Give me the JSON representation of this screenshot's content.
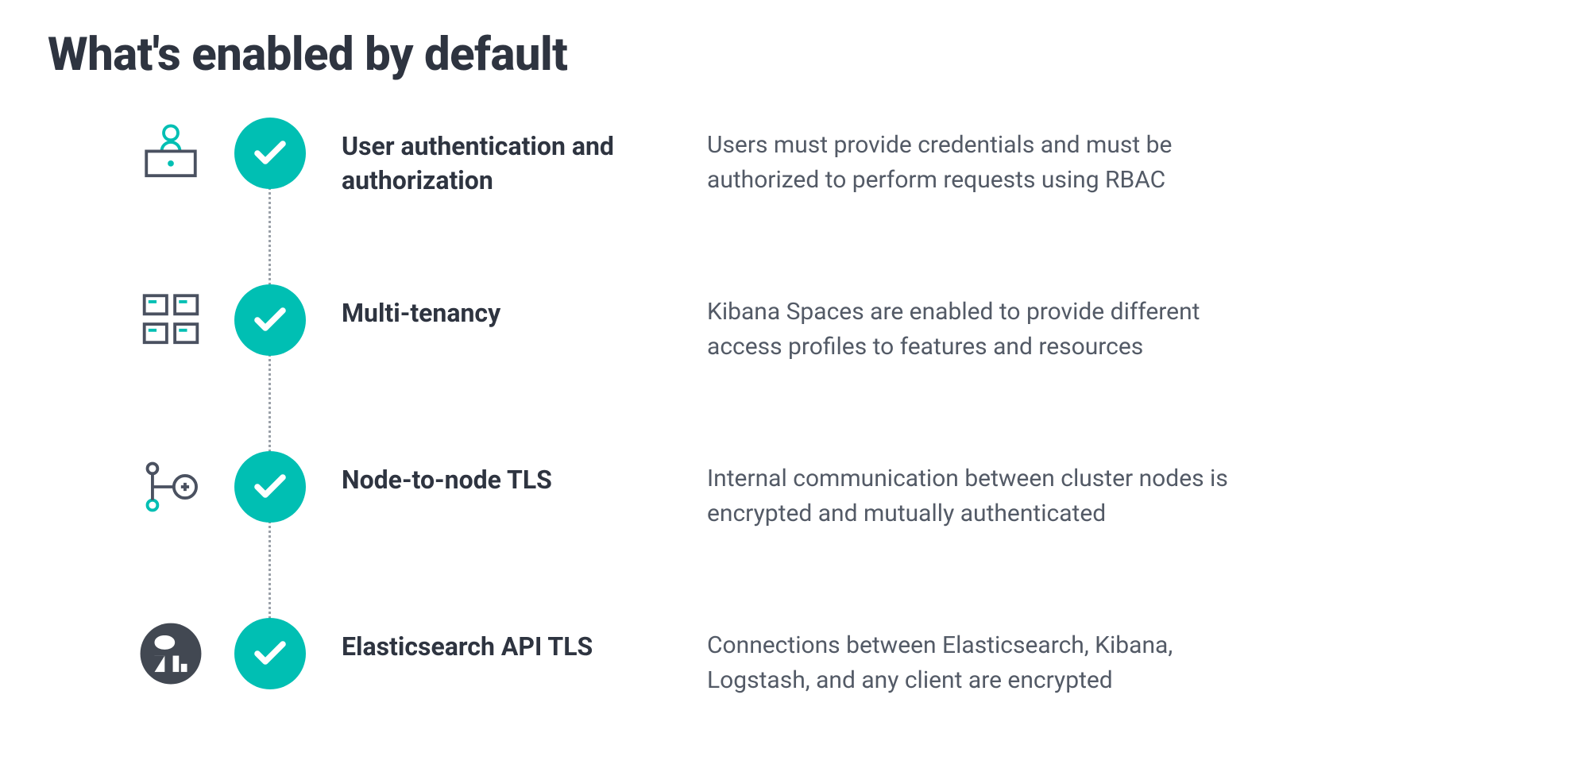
{
  "title": "What's enabled by default",
  "colors": {
    "accent": "#00bfb3",
    "heading": "#2e3440",
    "body": "#535a66"
  },
  "features": [
    {
      "icon": "user-auth-icon",
      "label": "User authentication and authorization",
      "description": "Users must provide credentials and must be authorized to perform requests using RBAC",
      "enabled": true
    },
    {
      "icon": "multi-tenancy-icon",
      "label": "Multi-tenancy",
      "description": "Kibana Spaces are enabled to provide different access profiles to features and resources",
      "enabled": true
    },
    {
      "icon": "node-tls-icon",
      "label": "Node-to-node TLS",
      "description": "Internal communication between cluster nodes is encrypted and mutually authenticated",
      "enabled": true
    },
    {
      "icon": "elasticsearch-tls-icon",
      "label": "Elasticsearch API TLS",
      "description": "Connections between Elasticsearch, Kibana, Logstash, and any client are encrypted",
      "enabled": true
    }
  ]
}
